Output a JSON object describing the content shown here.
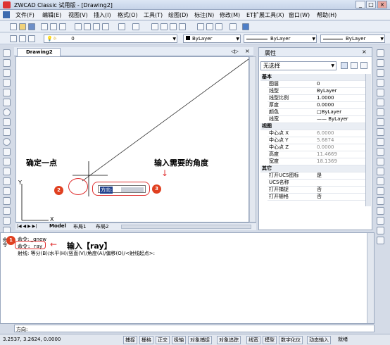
{
  "window": {
    "title": "ZWCAD Classic 试用版 - [Drawing2]",
    "min": "_",
    "max": "□",
    "close": "×"
  },
  "menu": [
    "文件(F)",
    "编辑(E)",
    "视图(V)",
    "插入(I)",
    "格式(O)",
    "工具(T)",
    "绘图(D)",
    "标注(N)",
    "修改(M)",
    "ET扩展工具(X)",
    "窗口(W)",
    "帮助(H)"
  ],
  "layer_combo": "0",
  "color_combo": "ByLayer",
  "linetype_combo": "ByLayer",
  "lineweight_combo": "ByLayer",
  "doc_tab": "Drawing2",
  "layout_tabs": [
    "Model",
    "布局1",
    "布局2"
  ],
  "drawing": {
    "angle_prompt": "方向:",
    "axis_x": "X",
    "axis_y": "Y"
  },
  "annotations": {
    "point": "确定一点",
    "angle": "输入需要的角度",
    "ray": "输入【ray】",
    "badges": [
      "1",
      "2",
      "3"
    ]
  },
  "properties": {
    "title": "属性",
    "selection": "无选择",
    "rows": [
      {
        "type": "cat",
        "k": "基本"
      },
      {
        "k": "图层",
        "v": "0"
      },
      {
        "k": "线型",
        "v": "ByLayer"
      },
      {
        "k": "线型比例",
        "v": "1.0000"
      },
      {
        "k": "厚度",
        "v": "0.0000"
      },
      {
        "k": "颜色",
        "v": "□ByLayer"
      },
      {
        "k": "线宽",
        "v": "—— ByLayer"
      },
      {
        "type": "cat",
        "k": "视图"
      },
      {
        "k": "中心点 X",
        "v": "6.0000",
        "dis": true
      },
      {
        "k": "中心点 Y",
        "v": "5.6874",
        "dis": true
      },
      {
        "k": "中心点 Z",
        "v": "0.0000",
        "dis": true
      },
      {
        "k": "高度",
        "v": "11.4669",
        "dis": true
      },
      {
        "k": "宽度",
        "v": "18.1369",
        "dis": true
      },
      {
        "type": "cat",
        "k": "其它"
      },
      {
        "k": "打开UCS图标",
        "v": "是"
      },
      {
        "k": "UCS名称",
        "v": ""
      },
      {
        "k": "打开捕捉",
        "v": "否"
      },
      {
        "k": "打开栅格",
        "v": "否"
      }
    ]
  },
  "command": {
    "lines": [
      "命令: _qnew",
      "命令: ray",
      "射线: 等分(B)/水平(H)/竖直(V)/角度(A)/偏移(O)/<射线起点>:"
    ],
    "side_label": "命令",
    "prompt": "方向:"
  },
  "status": {
    "coords": "3.2537, 3.2624, 0.0000",
    "buttons": [
      "捕捉",
      "栅格",
      "正交",
      "极轴",
      "对象捕捉",
      "对象追踪",
      "线宽",
      "模型",
      "数字化仪",
      "动态输入",
      "就绪"
    ]
  }
}
